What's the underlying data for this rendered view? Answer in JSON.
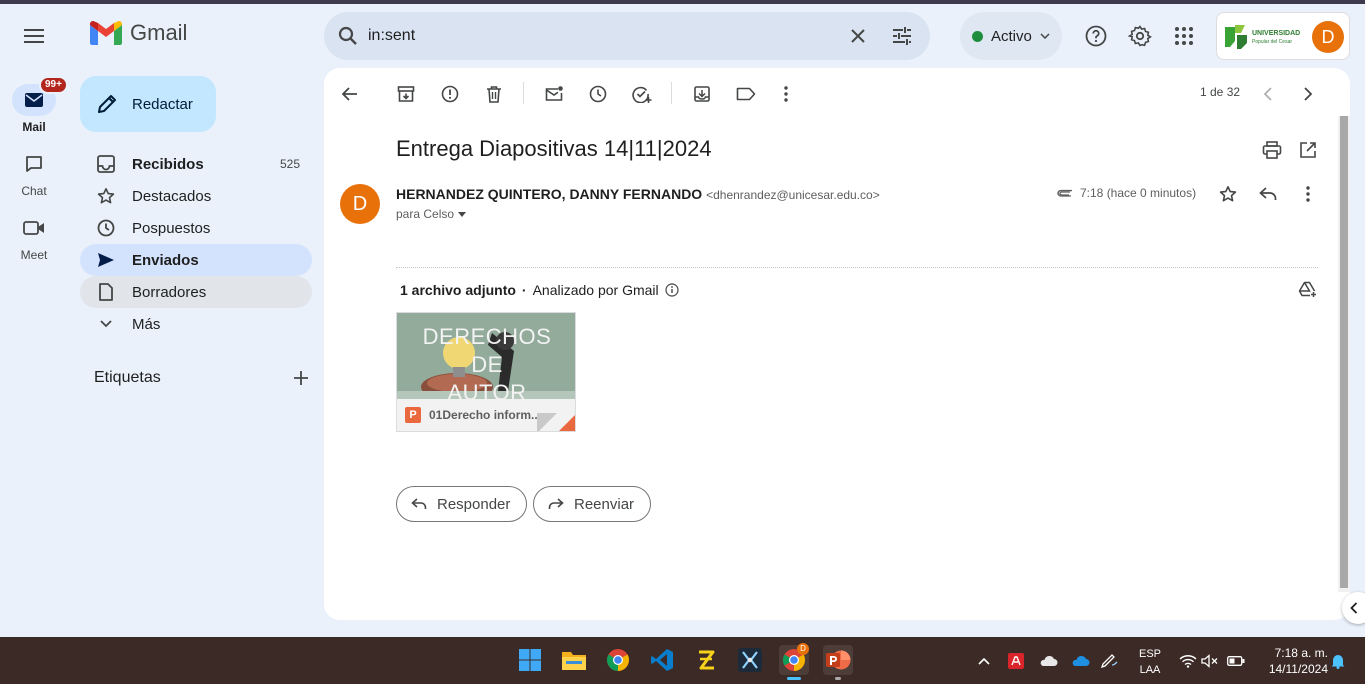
{
  "header": {
    "app_name": "Gmail",
    "search_query": "in:sent",
    "status": "Activo",
    "org_logo": {
      "line1": "UNIVERSIDAD",
      "line2": "Popular del Cesar"
    },
    "avatar_letter": "D",
    "colors": {
      "accent": "#0b57d0",
      "compose": "#c2e7ff",
      "active_nav": "#d3e3fd",
      "avatar": "#e8710a",
      "status_green": "#1e8e3e"
    }
  },
  "rail": {
    "mail_label": "Mail",
    "mail_badge": "99+",
    "chat_label": "Chat",
    "meet_label": "Meet"
  },
  "compose_label": "Redactar",
  "nav": {
    "items": [
      {
        "label": "Recibidos",
        "count": "525",
        "icon": "inbox-icon"
      },
      {
        "label": "Destacados",
        "icon": "star-icon"
      },
      {
        "label": "Pospuestos",
        "icon": "clock-icon"
      },
      {
        "label": "Enviados",
        "icon": "send-icon"
      },
      {
        "label": "Borradores",
        "icon": "draft-icon"
      },
      {
        "label": "Más",
        "icon": "chevron-down-icon"
      }
    ],
    "labels_title": "Etiquetas"
  },
  "toolbar": {
    "pager": "1 de 32"
  },
  "message": {
    "subject": "Entrega Diapositivas 14|11|2024",
    "sender_initial": "D",
    "sender_name": "HERNANDEZ QUINTERO, DANNY FERNANDO",
    "sender_email": "<dhenrandez@unicesar.edu.co>",
    "to": "para Celso",
    "time": "7:18 (hace 0 minutos)",
    "attachment_count": "1 archivo adjunto",
    "scan_note": "Analizado por Gmail",
    "attachment": {
      "thumb_title_line1": "DERECHOS",
      "thumb_title_line2": "DE",
      "thumb_title_line3": "AUTOR",
      "type_letter": "P",
      "filename": "01Derecho inform..."
    },
    "reply_label": "Responder",
    "forward_label": "Reenviar"
  },
  "taskbar": {
    "chrome_badge": "D",
    "lang": "ESP",
    "layout": "LAA",
    "time": "7:18 a. m.",
    "date": "14/11/2024"
  }
}
